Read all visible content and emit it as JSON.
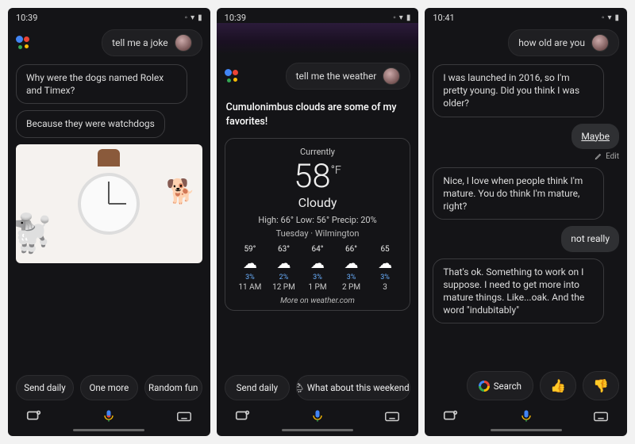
{
  "screens": [
    {
      "time": "10:39",
      "query": "tell me a joke",
      "joke": {
        "setup": "Why were the dogs named Rolex and Timex?",
        "punchline": "Because they were watchdogs"
      },
      "chips": [
        "Send daily",
        "One more",
        "Random fun"
      ]
    },
    {
      "time": "10:39",
      "query": "tell me the weather",
      "intro": "Cumulonimbus clouds are some of my favorites!",
      "weather": {
        "currently_label": "Currently",
        "temp": "58",
        "unit": "°F",
        "condition": "Cloudy",
        "high_label": "High:",
        "high": "66°",
        "low_label": "Low:",
        "low": "56°",
        "precip_label": "Precip:",
        "precip": "20%",
        "day": "Tuesday",
        "location": "Wilmington",
        "hours": [
          {
            "temp": "59°",
            "precip": "3%",
            "time": "11 AM"
          },
          {
            "temp": "63°",
            "precip": "2%",
            "time": "12 PM"
          },
          {
            "temp": "64°",
            "precip": "3%",
            "time": "1 PM"
          },
          {
            "temp": "66°",
            "precip": "3%",
            "time": "2 PM"
          },
          {
            "temp": "65",
            "precip": "3%",
            "time": "3"
          }
        ],
        "more": "More on weather.com"
      },
      "chips": [
        "Send daily",
        "🌦 What about this weekend?"
      ]
    },
    {
      "time": "10:41",
      "query": "how old are you",
      "messages": [
        {
          "role": "assistant",
          "text": "I was launched in 2016, so I'm pretty young. Did you think I was older?"
        },
        {
          "role": "user",
          "text": "Maybe",
          "edit": true
        },
        {
          "role": "assistant",
          "text": "Nice, I love when people think I'm mature. You do think I'm mature, right?"
        },
        {
          "role": "user",
          "text": "not really"
        },
        {
          "role": "assistant",
          "text": "That's ok. Something to work on I suppose. I need to get more into mature things. Like...oak. And the word \"indubitably\""
        }
      ],
      "edit_label": "Edit",
      "search_label": "Search"
    }
  ]
}
